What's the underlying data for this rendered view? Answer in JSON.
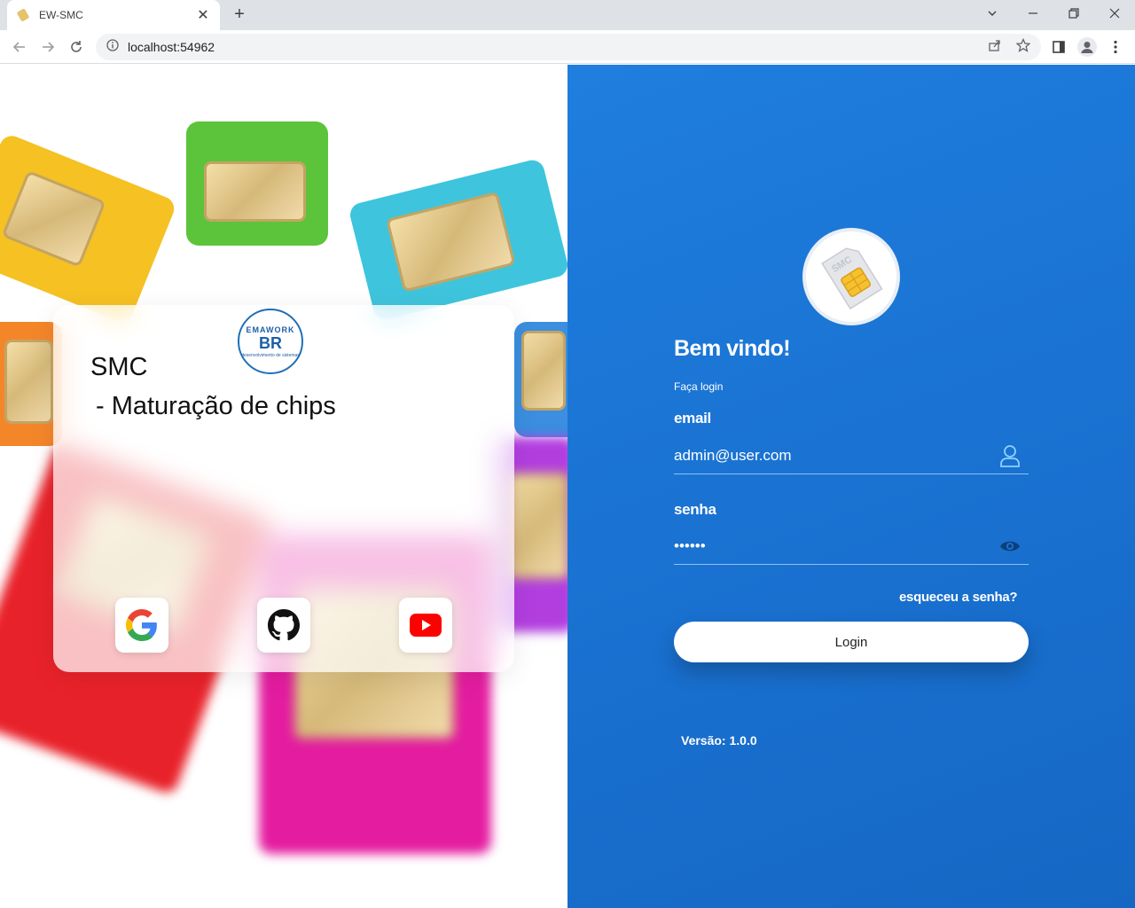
{
  "browser": {
    "tab_title": "EW-SMC",
    "tab_close": "✕",
    "new_tab": "+",
    "url": "localhost:54962"
  },
  "left_panel": {
    "title_line1": "SMC",
    "title_line2": "- Maturação de chips",
    "logo_text_top": "EMAWORK",
    "logo_text_mid": "BR",
    "logo_text_bottom": "desenvolvimento de sistemas",
    "social": [
      {
        "name": "google",
        "icon": "google-icon"
      },
      {
        "name": "github",
        "icon": "github-icon"
      },
      {
        "name": "youtube",
        "icon": "youtube-icon"
      }
    ]
  },
  "login": {
    "avatar_text": "SMC",
    "welcome": "Bem vindo!",
    "subtitle": "Faça login",
    "email_label": "email",
    "email_value": "admin@user.com",
    "password_label": "senha",
    "password_value": "••••••",
    "forgot": "esqueceu a senha?",
    "button": "Login",
    "version": "Versão: 1.0.0"
  },
  "colors": {
    "panel_blue": "#1a73d3",
    "accent": "#1d5fa8"
  }
}
